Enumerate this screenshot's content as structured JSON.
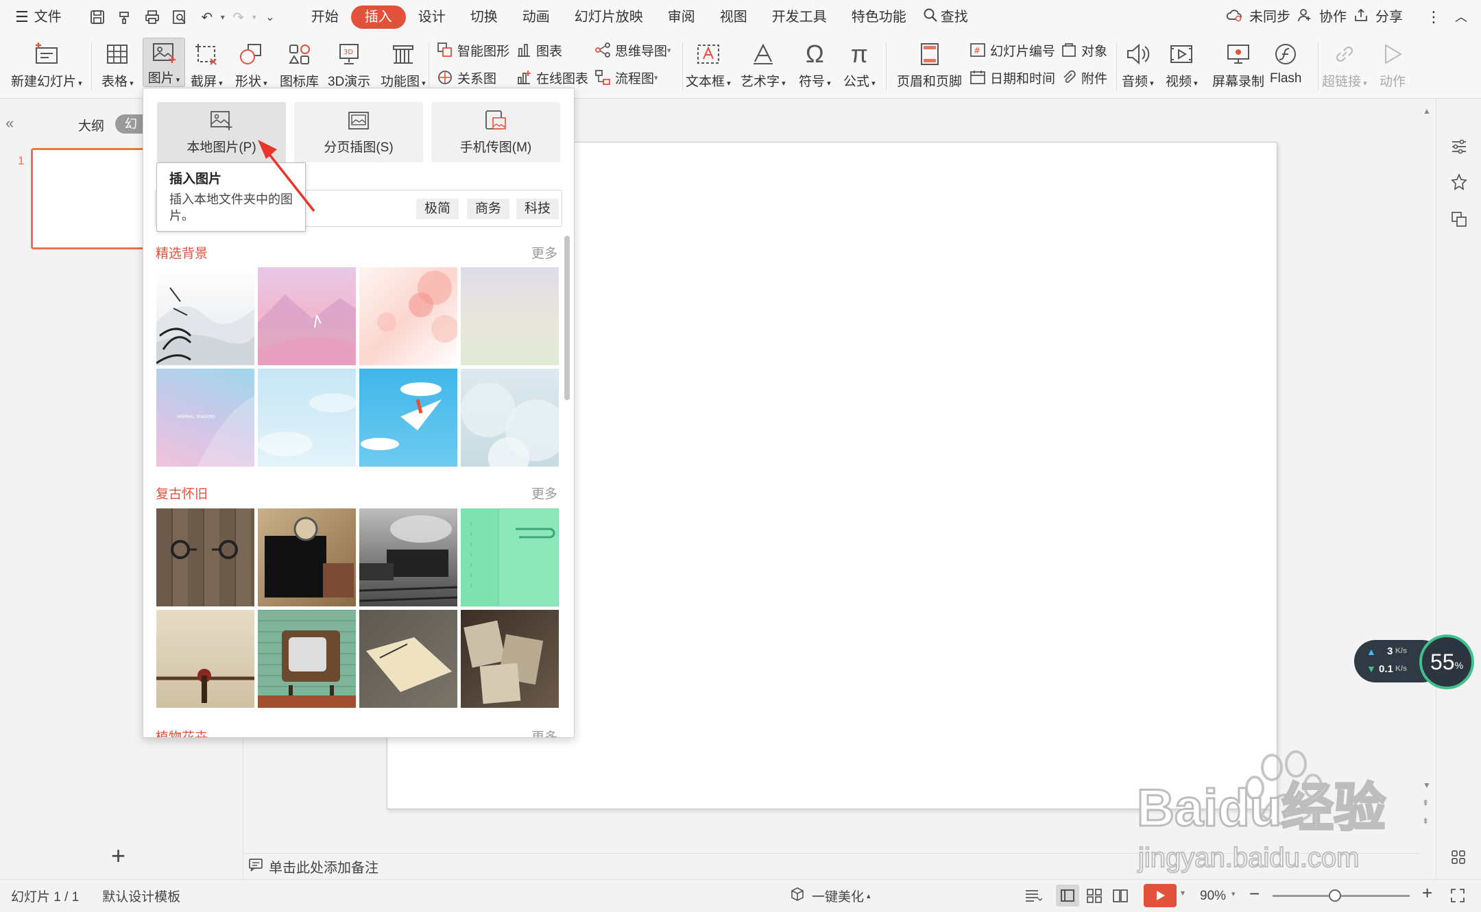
{
  "menubar": {
    "file": "文件",
    "tabs": [
      "开始",
      "插入",
      "设计",
      "切换",
      "动画",
      "幻灯片放映",
      "审阅",
      "视图",
      "开发工具",
      "特色功能"
    ],
    "active_tab": "插入",
    "search": "查找",
    "right": {
      "sync": "未同步",
      "collab": "协作",
      "share": "分享"
    }
  },
  "ribbon": {
    "new_slide": "新建幻灯片",
    "table": "表格",
    "picture": "图片",
    "screenshot": "截屏",
    "shape": "形状",
    "icon_lib": "图标库",
    "demo3d": "3D演示",
    "func_chart": "功能图",
    "smart_shape": "智能图形",
    "chart": "图表",
    "relation": "关系图",
    "online_chart": "在线图表",
    "mindmap": "思维导图",
    "flowchart": "流程图",
    "textbox": "文本框",
    "wordart": "艺术字",
    "symbol": "符号",
    "formula": "公式",
    "header_footer": "页眉和页脚",
    "slide_number": "幻灯片编号",
    "object": "对象",
    "datetime": "日期和时间",
    "attachment": "附件",
    "audio": "音频",
    "video": "视频",
    "screen_record": "屏幕录制",
    "flash": "Flash",
    "hyperlink": "超链接",
    "action": "动作",
    "icon_3d_text": "3D"
  },
  "leftpanel": {
    "outline": "大纲",
    "slides_tab": "幻",
    "slide_num": "1",
    "add": "+"
  },
  "dropdown": {
    "buttons": [
      "本地图片(P)",
      "分页插图(S)",
      "手机传图(M)"
    ],
    "tags": [
      "极简",
      "商务",
      "科技"
    ],
    "sections": [
      {
        "title": "精选背景",
        "more": "更多"
      },
      {
        "title": "复古怀旧",
        "more": "更多"
      },
      {
        "title": "植物花卉",
        "more": "更多"
      }
    ],
    "tile_caption": "MINIMAL SEASONS"
  },
  "tooltip": {
    "title": "插入图片",
    "desc_line1": "插入本地文件夹中的图",
    "desc_line2": "片。"
  },
  "notes": {
    "placeholder": "单击此处添加备注"
  },
  "status": {
    "slide_info": "幻灯片 1 / 1",
    "template": "默认设计模板",
    "beautify": "一键美化",
    "zoom": "90%"
  },
  "speed": {
    "up": "3",
    "up_unit": "K/s",
    "down": "0.1",
    "down_unit": "K/s",
    "percent": "55",
    "percent_unit": "%"
  },
  "watermark": {
    "brand": "Baidu经验",
    "url": "jingyan.baidu.com"
  },
  "colors": {
    "accent": "#e2513a",
    "thumb_border": "#e8734c",
    "progress": "#3ec48a"
  }
}
